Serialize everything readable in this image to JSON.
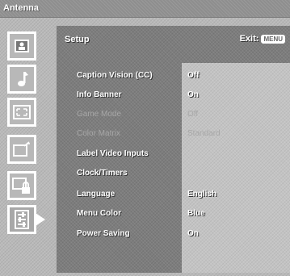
{
  "window": {
    "title": "Antenna"
  },
  "header": {
    "title": "Setup",
    "exit_label": "Exit:",
    "menu_badge": "MENU"
  },
  "sidebar": {
    "items": [
      {
        "name": "picture-icon"
      },
      {
        "name": "music-note-icon"
      },
      {
        "name": "screen-adjust-icon"
      },
      {
        "name": "channel-icon"
      },
      {
        "name": "lock-icon"
      },
      {
        "name": "setup-icon",
        "active": true
      }
    ]
  },
  "settings": [
    {
      "label": "Caption Vision (CC)",
      "value": "Off",
      "enabled": true
    },
    {
      "label": "Info Banner",
      "value": "On",
      "enabled": true
    },
    {
      "label": "Game Mode",
      "value": "Off",
      "enabled": false
    },
    {
      "label": "Color Matrix",
      "value": "Standard",
      "enabled": false
    },
    {
      "label": "Label Video Inputs",
      "value": "",
      "enabled": true
    },
    {
      "label": "Clock/Timers",
      "value": "",
      "enabled": true
    },
    {
      "label": "Language",
      "value": "English",
      "enabled": true
    },
    {
      "label": "Menu Color",
      "value": "Blue",
      "enabled": true
    },
    {
      "label": "Power Saving",
      "value": "On",
      "enabled": true
    }
  ]
}
